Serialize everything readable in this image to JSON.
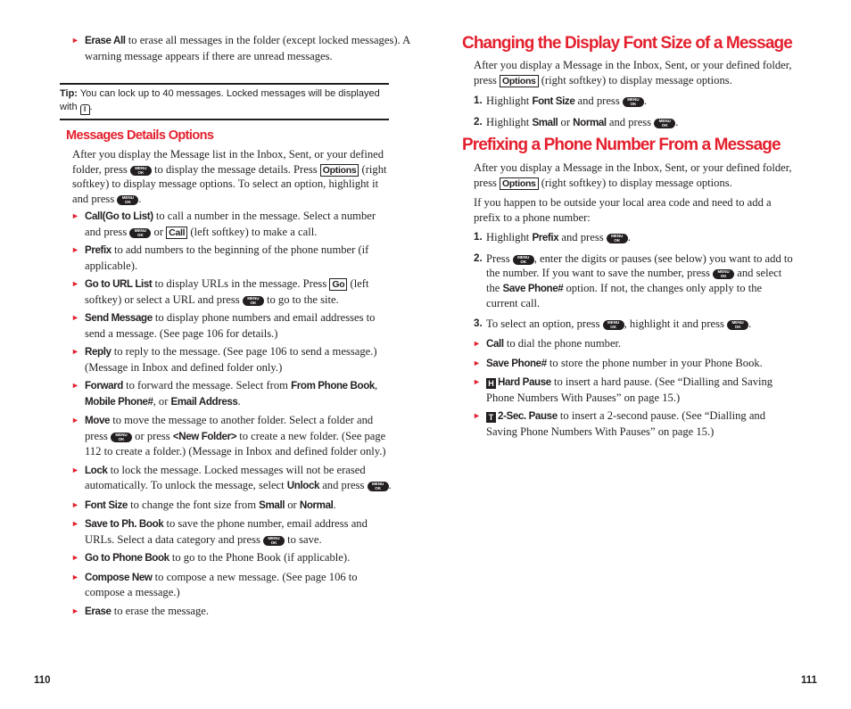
{
  "left_page": {
    "page_number": "110",
    "erase_all": {
      "term": "Erase All",
      "text": " to erase all messages in the folder (except locked messages). A warning message appears if there are unread messages."
    },
    "tip": {
      "label": "Tip:",
      "text": " You can lock up to 40 messages. Locked messages will be displayed with ",
      "end": ".",
      "icon": "lock-icon"
    },
    "section_title": "Messages Details Options",
    "intro": {
      "t1": "After you display the Message list in the Inbox, Sent, or your defined folder, press ",
      "t2": " to display the message details. Press ",
      "softkey": "Options",
      "t3": " (right softkey) to display message options. To select an option, highlight it and press ",
      "t4": "."
    },
    "menu_key": {
      "top": "MENU",
      "bottom": "OK"
    },
    "items": {
      "call": {
        "term": "Call(Go to List)",
        "t1": " to call a number in the message. Select a number and press ",
        "t2": " or ",
        "softkey": "Call",
        "t3": " (left softkey) to make a call."
      },
      "prefix": {
        "term": "Prefix",
        "t1": " to add numbers to the beginning of the phone number (if applicable)."
      },
      "url": {
        "term": "Go to URL List",
        "t1": " to display URLs in the message. Press ",
        "softkey": "Go",
        "t2": " (left softkey) or select a URL and press ",
        "t3": " to go to the site."
      },
      "send": {
        "term": "Send Message",
        "t1": " to display phone numbers and email addresses to send a message. (See page 106 for details.)"
      },
      "reply": {
        "term": "Reply",
        "t1": " to reply to the message. (See page 106 to send a message.) (Message in Inbox and defined folder only.)"
      },
      "forward": {
        "term": "Forward",
        "t1": " to forward the message. Select from ",
        "o1": "From Phone Book",
        "t2": ", ",
        "o2": "Mobile Phone#",
        "t3": ", or ",
        "o3": "Email Address",
        "t4": "."
      },
      "move": {
        "term": "Move",
        "t1": " to move the message to another folder. Select a folder and press ",
        "t2": " or press ",
        "o1": "<New Folder>",
        "t3": " to create a new folder. (See page 112 to create a folder.) (Message in Inbox and defined folder only.)"
      },
      "lock": {
        "term": "Lock",
        "t1": " to lock the message. Locked messages will not be erased automatically. To unlock the message, select ",
        "o1": "Unlock",
        "t2": " and press ",
        "t3": "."
      },
      "font": {
        "term": "Font Size",
        "t1": " to change the font size from ",
        "o1": "Small",
        "t2": " or ",
        "o2": "Normal",
        "t3": "."
      },
      "save": {
        "term": "Save to Ph. Book",
        "t1": " to save the phone number, email address and URLs. Select a data category and press ",
        "t2": " to save."
      },
      "phonebook": {
        "term": "Go to Phone Book",
        "t1": " to go to the Phone Book (if applicable)."
      },
      "compose": {
        "term": "Compose New",
        "t1": " to compose a new message. (See page 106 to compose a message.)"
      },
      "erase": {
        "term": "Erase",
        "t1": " to erase the message."
      }
    }
  },
  "right_page": {
    "page_number": "111",
    "font_section": {
      "title": "Changing the Display Font Size of a Message",
      "intro_t1": "After you display a Message in the Inbox, Sent, or your defined folder, press ",
      "softkey": "Options",
      "intro_t2": " (right softkey) to display message options.",
      "steps": [
        {
          "n": "1.",
          "t1": "Highlight ",
          "o1": "Font Size",
          "t2": " and press ",
          "t3": "."
        },
        {
          "n": "2.",
          "t1": "Highlight ",
          "o1": "Small",
          "t2": " or ",
          "o2": "Normal",
          "t3": " and press ",
          "t4": "."
        }
      ]
    },
    "prefix_section": {
      "title": "Prefixing a Phone Number From a Message",
      "intro_t1": "After you display a Message in the Inbox, Sent, or your defined folder, press ",
      "softkey": "Options",
      "intro_t2": " (right softkey) to display message options.",
      "para": "If you happen to be outside your local area code and need to add a prefix to a phone number:",
      "steps": [
        {
          "n": "1.",
          "t1": "Highlight ",
          "o1": "Prefix",
          "t2": " and press ",
          "t3": "."
        },
        {
          "n": "2.",
          "t1": "Press ",
          "t2": ", enter the digits or pauses (see below) you want to add to the number. If you want to save the number, press ",
          "t3": " and select the ",
          "o1": "Save Phone#",
          "t4": " option. If not, the changes only apply to the current call."
        },
        {
          "n": "3.",
          "t1": "To select an option, press ",
          "t2": ", highlight it and press ",
          "t3": "."
        }
      ],
      "options": [
        {
          "term": "Call",
          "t1": " to dial the phone number."
        },
        {
          "term": "Save Phone#",
          "t1": " to store the phone number in your Phone Book."
        },
        {
          "icon": "H",
          "term": "Hard Pause",
          "t1": " to insert a hard pause. (See “Dialling and Saving Phone Numbers With Pauses” on page 15.)"
        },
        {
          "icon": "T",
          "term": "2-Sec. Pause",
          "t1": " to insert a 2-second pause. (See “Dialling and Saving Phone Numbers With Pauses” on page 15.)"
        }
      ]
    }
  }
}
